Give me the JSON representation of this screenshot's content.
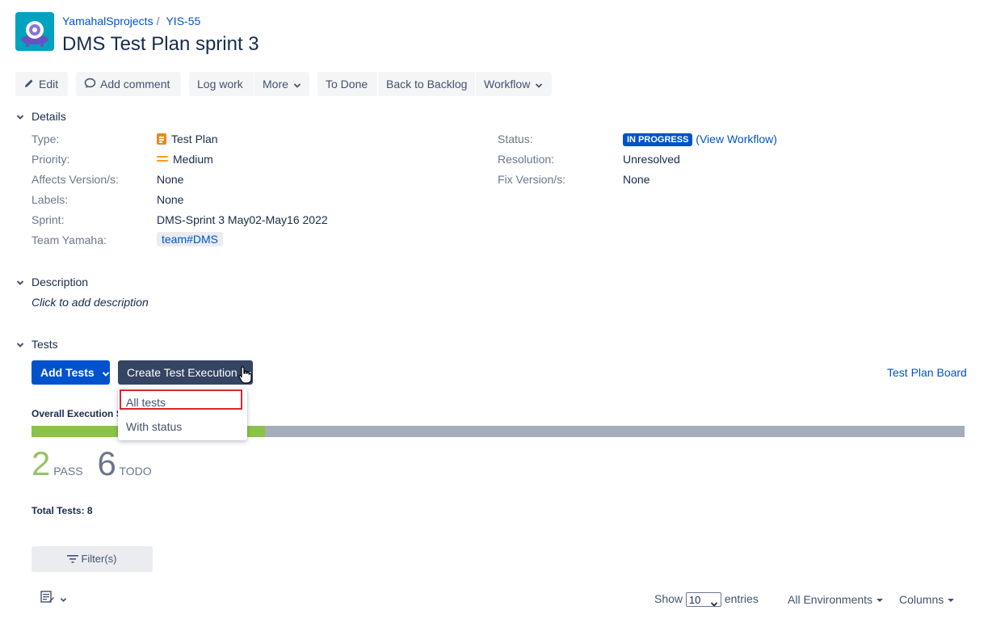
{
  "header": {
    "project_name": "YamahalSprojects",
    "separator": "/",
    "issue_key": "YIS-55",
    "title": "DMS Test Plan sprint 3"
  },
  "toolbar": {
    "edit": "Edit",
    "add_comment": "Add comment",
    "log_work": "Log work",
    "more": "More",
    "to_done": "To Done",
    "back_to_backlog": "Back to Backlog",
    "workflow": "Workflow"
  },
  "details": {
    "heading": "Details",
    "left": [
      {
        "label": "Type:",
        "value": "Test Plan"
      },
      {
        "label": "Priority:",
        "value": "Medium"
      },
      {
        "label": "Affects Version/s:",
        "value": "None"
      },
      {
        "label": "Labels:",
        "value": "None"
      },
      {
        "label": "Sprint:",
        "value": "DMS-Sprint 3 May02-May16 2022"
      },
      {
        "label": "Team Yamaha:",
        "value": "team#DMS"
      }
    ],
    "right": [
      {
        "label": "Status:",
        "value": "IN PROGRESS",
        "link": "(View Workflow)"
      },
      {
        "label": "Resolution:",
        "value": "Unresolved"
      },
      {
        "label": "Fix Version/s:",
        "value": "None"
      }
    ]
  },
  "description": {
    "heading": "Description",
    "placeholder": "Click to add description"
  },
  "tests": {
    "heading": "Tests",
    "add_tests": "Add Tests",
    "create_execution": "Create Test Execution",
    "board_link": "Test Plan Board",
    "dropdown": [
      "All tests",
      "With status"
    ],
    "overall_title": "Overall Execution St",
    "progress_pass_fraction": 0.25,
    "pass_count": "2",
    "pass_label": "PASS",
    "todo_count": "6",
    "todo_label": "TODO",
    "total": "Total Tests: 8",
    "filter": "Filter(s)",
    "show_label": "Show",
    "entries_value": "10",
    "entries_label": "entries",
    "environments": "All Environments",
    "columns": "Columns"
  },
  "colors": {
    "link": "#0052cc",
    "primary": "#0052cc",
    "dark_button": "#344563",
    "pass": "#8bc34a",
    "todo": "#a5adba",
    "highlight": "#d9262d"
  }
}
